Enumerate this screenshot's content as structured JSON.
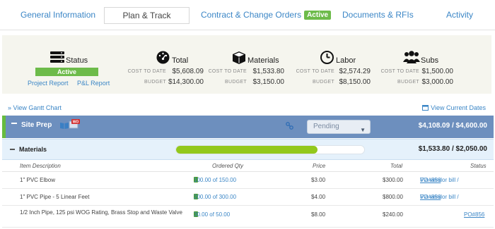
{
  "tabs": {
    "general": "General Information",
    "plan": "Plan & Track",
    "contract": "Contract & Change Orders",
    "contract_badge": "Active",
    "documents": "Documents & RFIs",
    "activity": "Activity"
  },
  "summary": {
    "status": {
      "title": "Status",
      "value": "Active",
      "project_report": "Project Report",
      "pl_report": "P&L Report"
    },
    "labels": {
      "cost_to_date": "COST TO DATE",
      "budget": "BUDGET"
    },
    "total": {
      "title": "Total",
      "cost_to_date": "$5,608.09",
      "budget": "$14,300.00"
    },
    "materials": {
      "title": "Materials",
      "cost_to_date": "$1,533.80",
      "budget": "$3,150.00"
    },
    "labor": {
      "title": "Labor",
      "cost_to_date": "$2,574.29",
      "budget": "$8,150.00"
    },
    "subs": {
      "title": "Subs",
      "cost_to_date": "$1,500.00",
      "budget": "$3,000.00"
    }
  },
  "links": {
    "gantt": "» View Gantt Chart",
    "current_dates": "View Current Dates"
  },
  "site_prep": {
    "name": "Site Prep",
    "wo_badge": "WO",
    "status_select": "Pending",
    "amount": "$4,108.09 / $4,600.00"
  },
  "materials_row": {
    "name": "Materials",
    "progress_fraction": 0.75,
    "amount": "$1,533.80 / $2,050.00"
  },
  "table": {
    "headers": {
      "description": "Item Description",
      "ordered_qty": "Ordered Qty",
      "price": "Price",
      "total": "Total",
      "status": "Status"
    },
    "rows": [
      {
        "description": "1\" PVC Elbow",
        "qty": "100.00 of 150.00",
        "price": "$3.00",
        "total": "$300.00",
        "status_pre": "Via vendor bill / ",
        "status_link": "PO#856"
      },
      {
        "description": "1\" PVC Pipe - 5 Linear Feet",
        "qty": "200.00 of 300.00",
        "price": "$4.00",
        "total": "$800.00",
        "status_pre": "Via vendor bill / ",
        "status_link": "PO#856"
      },
      {
        "description": "1/2 Inch Pipe, 125 psi WOG Rating, Brass Stop and Waste Valve",
        "qty": "30.00 of 50.00",
        "price": "$8.00",
        "total": "$240.00",
        "status_pre": "",
        "status_link": "PO#856"
      }
    ]
  },
  "colors": {
    "accent_blue": "#3b86c6",
    "active_green": "#6dbb4a",
    "section_blue": "#6d8fbe",
    "progress_green": "#92c81c"
  }
}
